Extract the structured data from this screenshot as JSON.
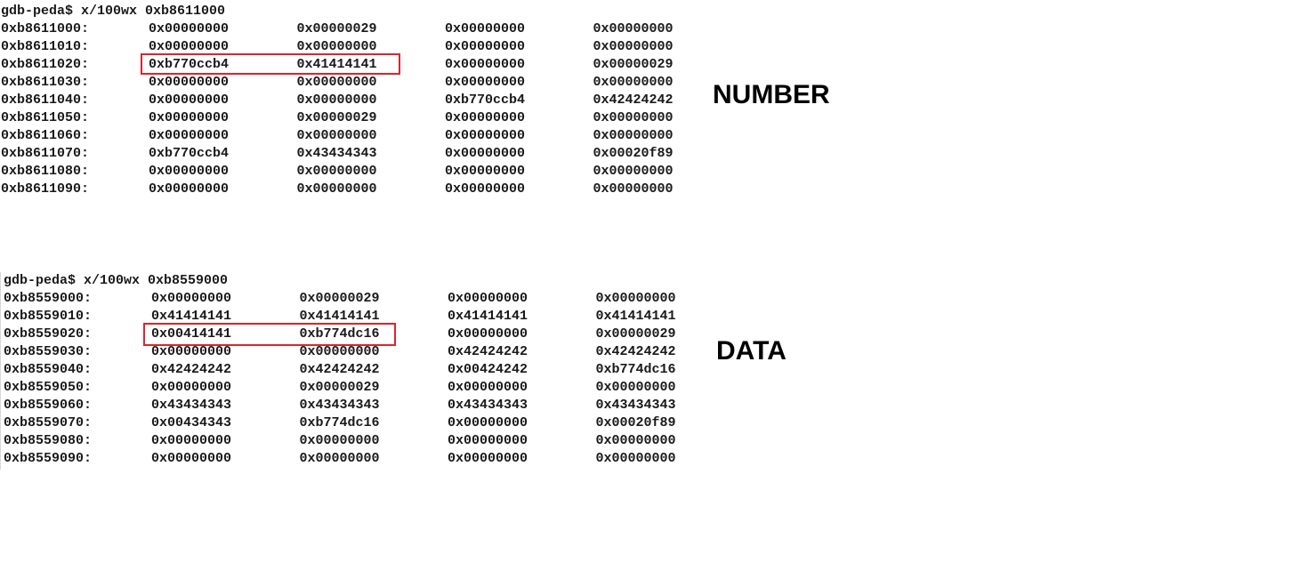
{
  "dumps": [
    {
      "command": "gdb-peda$ x/100wx 0xb8611000",
      "label": "NUMBER",
      "rows": [
        {
          "addr": "0xb8611000:",
          "words": [
            "0x00000000",
            "0x00000029",
            "0x00000000",
            "0x00000000"
          ]
        },
        {
          "addr": "0xb8611010:",
          "words": [
            "0x00000000",
            "0x00000000",
            "0x00000000",
            "0x00000000"
          ]
        },
        {
          "addr": "0xb8611020:",
          "words": [
            "0xb770ccb4",
            "0x41414141",
            "0x00000000",
            "0x00000029"
          ]
        },
        {
          "addr": "0xb8611030:",
          "words": [
            "0x00000000",
            "0x00000000",
            "0x00000000",
            "0x00000000"
          ]
        },
        {
          "addr": "0xb8611040:",
          "words": [
            "0x00000000",
            "0x00000000",
            "0xb770ccb4",
            "0x42424242"
          ]
        },
        {
          "addr": "0xb8611050:",
          "words": [
            "0x00000000",
            "0x00000029",
            "0x00000000",
            "0x00000000"
          ]
        },
        {
          "addr": "0xb8611060:",
          "words": [
            "0x00000000",
            "0x00000000",
            "0x00000000",
            "0x00000000"
          ]
        },
        {
          "addr": "0xb8611070:",
          "words": [
            "0xb770ccb4",
            "0x43434343",
            "0x00000000",
            "0x00020f89"
          ]
        },
        {
          "addr": "0xb8611080:",
          "words": [
            "0x00000000",
            "0x00000000",
            "0x00000000",
            "0x00000000"
          ]
        },
        {
          "addr": "0xb8611090:",
          "words": [
            "0x00000000",
            "0x00000000",
            "0x00000000",
            "0x00000000"
          ]
        }
      ]
    },
    {
      "command": "gdb-peda$ x/100wx 0xb8559000",
      "label": "DATA",
      "rows": [
        {
          "addr": "0xb8559000:",
          "words": [
            "0x00000000",
            "0x00000029",
            "0x00000000",
            "0x00000000"
          ]
        },
        {
          "addr": "0xb8559010:",
          "words": [
            "0x41414141",
            "0x41414141",
            "0x41414141",
            "0x41414141"
          ]
        },
        {
          "addr": "0xb8559020:",
          "words": [
            "0x00414141",
            "0xb774dc16",
            "0x00000000",
            "0x00000029"
          ]
        },
        {
          "addr": "0xb8559030:",
          "words": [
            "0x00000000",
            "0x00000000",
            "0x42424242",
            "0x42424242"
          ]
        },
        {
          "addr": "0xb8559040:",
          "words": [
            "0x42424242",
            "0x42424242",
            "0x00424242",
            "0xb774dc16"
          ]
        },
        {
          "addr": "0xb8559050:",
          "words": [
            "0x00000000",
            "0x00000029",
            "0x00000000",
            "0x00000000"
          ]
        },
        {
          "addr": "0xb8559060:",
          "words": [
            "0x43434343",
            "0x43434343",
            "0x43434343",
            "0x43434343"
          ]
        },
        {
          "addr": "0xb8559070:",
          "words": [
            "0x00434343",
            "0xb774dc16",
            "0x00000000",
            "0x00020f89"
          ]
        },
        {
          "addr": "0xb8559080:",
          "words": [
            "0x00000000",
            "0x00000000",
            "0x00000000",
            "0x00000000"
          ]
        },
        {
          "addr": "0xb8559090:",
          "words": [
            "0x00000000",
            "0x00000000",
            "0x00000000",
            "0x00000000"
          ]
        }
      ]
    }
  ],
  "highlight_color": "#d7262d"
}
